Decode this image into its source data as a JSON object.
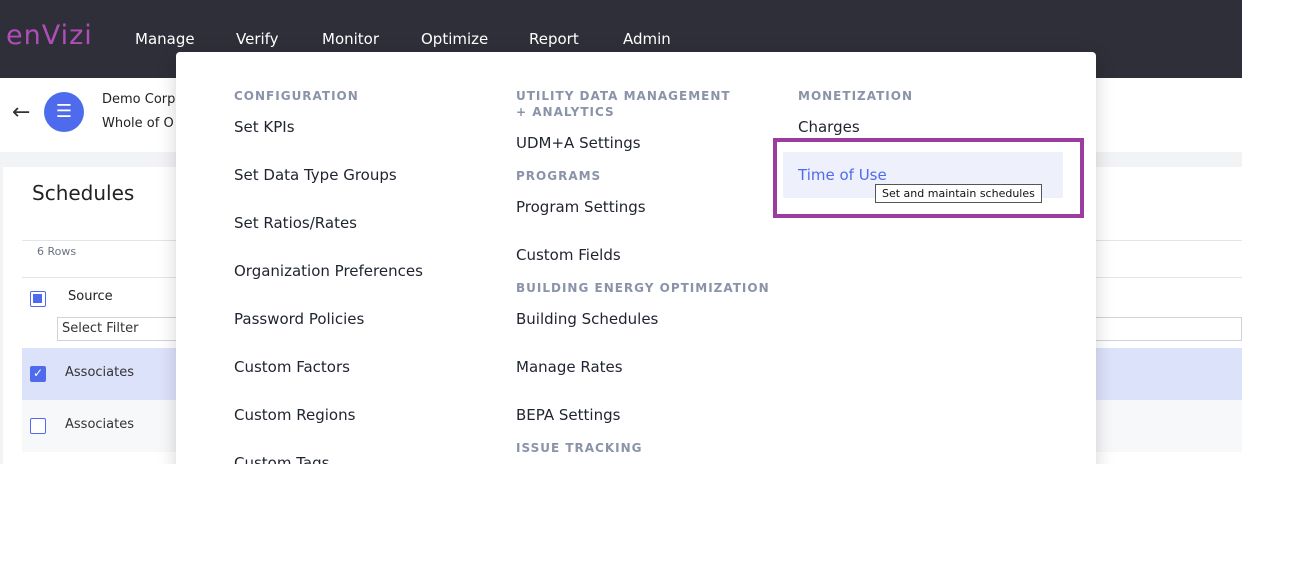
{
  "app": {
    "logo": "enVizi"
  },
  "nav": {
    "items": [
      "Manage",
      "Verify",
      "Monitor",
      "Optimize",
      "Report",
      "Admin"
    ]
  },
  "header": {
    "back_icon": "arrow-left-icon",
    "menu_icon": "hamburger-icon",
    "breadcrumb_line1": "Demo Corpo",
    "breadcrumb_line2": "Whole of O"
  },
  "page": {
    "title": "Schedules",
    "rows_count": "6 Rows",
    "column_source": "Source",
    "filter_placeholder": "Select Filter",
    "rows": [
      {
        "source": "Associates",
        "checked": true
      },
      {
        "source": "Associates",
        "checked": false
      }
    ]
  },
  "mega_menu": {
    "col1": {
      "section": "CONFIGURATION",
      "items": [
        "Set KPIs",
        "Set Data Type Groups",
        "Set Ratios/Rates",
        "Organization Preferences",
        "Password Policies",
        "Custom Factors",
        "Custom Regions",
        "Custom Tags"
      ]
    },
    "col2": {
      "udm_section": "UTILITY DATA MANAGEMENT + ANALYTICS",
      "udm_items": [
        "UDM+A Settings"
      ],
      "programs_section": "PROGRAMS",
      "programs_items": [
        "Program Settings",
        "Custom Fields"
      ],
      "beo_section": "BUILDING ENERGY OPTIMIZATION",
      "beo_items": [
        "Building Schedules",
        "Manage Rates",
        "BEPA Settings"
      ],
      "issue_section": "ISSUE TRACKING"
    },
    "col3": {
      "section": "MONETIZATION",
      "items": [
        "Charges",
        "Time of Use"
      ]
    },
    "tooltip": "Set and maintain schedules"
  },
  "colors": {
    "topbar": "#2e2f38",
    "logo": "#b04db9",
    "accent": "#4f6bed",
    "highlight_box": "#9b3c9e"
  }
}
